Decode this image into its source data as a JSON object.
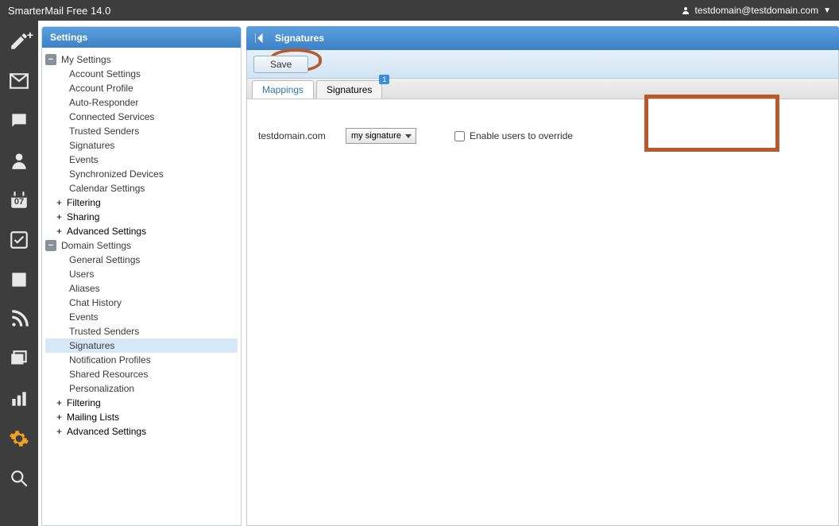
{
  "app": {
    "title": "SmarterMail Free 14.0",
    "user": "testdomain@testdomain.com"
  },
  "iconbar": {
    "calendar_day": "07"
  },
  "settings_panel": {
    "header": "Settings",
    "my_settings": {
      "label": "My Settings",
      "items": [
        "Account Settings",
        "Account Profile",
        "Auto-Responder",
        "Connected Services",
        "Trusted Senders",
        "Signatures",
        "Events",
        "Synchronized Devices",
        "Calendar Settings"
      ],
      "sub1": "Filtering",
      "sub2": "Sharing",
      "sub3": "Advanced Settings"
    },
    "domain_settings": {
      "label": "Domain Settings",
      "items": [
        "General Settings",
        "Users",
        "Aliases",
        "Chat History",
        "Events",
        "Trusted Senders",
        "Signatures",
        "Notification Profiles",
        "Shared Resources",
        "Personalization"
      ],
      "sub1": "Filtering",
      "sub2": "Mailing Lists",
      "sub3": "Advanced Settings"
    }
  },
  "content": {
    "header": "Signatures",
    "save_label": "Save",
    "tabs": {
      "mappings": "Mappings",
      "signatures": "Signatures",
      "badge": "1"
    },
    "mapping": {
      "domain": "testdomain.com",
      "selected_signature": "my signature",
      "override_label": "Enable users to override"
    }
  }
}
